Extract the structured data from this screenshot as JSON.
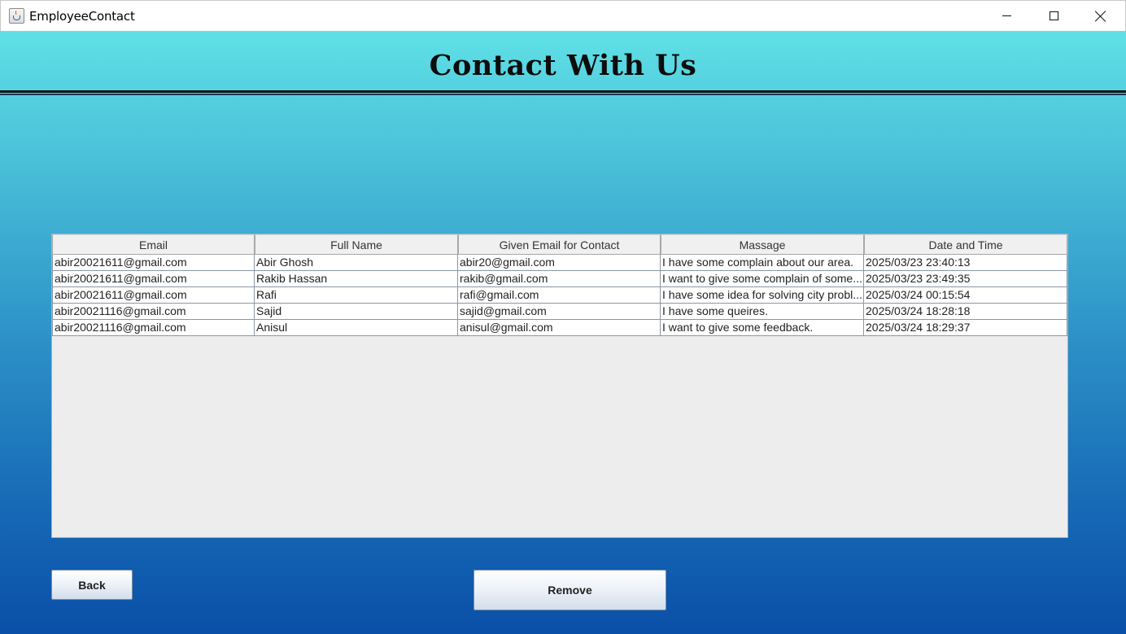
{
  "window": {
    "title": "EmployeeContact",
    "icon": "java-cup-icon",
    "controls": [
      "minimize-icon",
      "maximize-icon",
      "close-icon"
    ]
  },
  "header": {
    "title": "Contact With Us"
  },
  "table": {
    "columns": [
      "Email",
      "Full Name",
      "Given Email for Contact",
      "Massage",
      "Date and Time"
    ],
    "rows": [
      [
        "abir20021611@gmail.com",
        "Abir Ghosh",
        "abir20@gmail.com",
        "I have some complain about our area.",
        "2025/03/23 23:40:13"
      ],
      [
        "abir20021611@gmail.com",
        "Rakib Hassan",
        "rakib@gmail.com",
        "I want to give some complain of some...",
        "2025/03/23 23:49:35"
      ],
      [
        "abir20021611@gmail.com",
        "Rafi",
        "rafi@gmail.com",
        "I have some idea for solving city probl...",
        "2025/03/24 00:15:54"
      ],
      [
        "abir20021116@gmail.com",
        "Sajid",
        "sajid@gmail.com",
        "I have some queires.",
        "2025/03/24 18:28:18"
      ],
      [
        "abir20021116@gmail.com",
        "Anisul",
        "anisul@gmail.com",
        "I want to give some feedback.",
        "2025/03/24 18:29:37"
      ]
    ]
  },
  "buttons": {
    "back": "Back",
    "remove": "Remove"
  },
  "colors": {
    "background_top": "#5fe0e6",
    "background_bottom": "#0a4fa8",
    "title_text": "#0d0d0d"
  }
}
